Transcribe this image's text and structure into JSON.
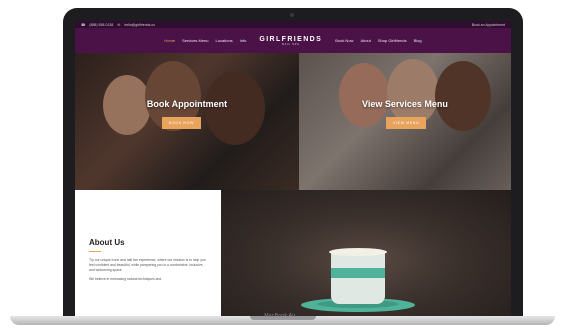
{
  "device": {
    "label": "MacBook Air"
  },
  "topbar": {
    "phone": "(888) 555-0138",
    "email": "hello@girlfriends.co",
    "right_text": "Book an Appointment"
  },
  "nav": {
    "items_left": [
      "Home",
      "Services Menu",
      "Locations",
      "Info"
    ],
    "items_right": [
      "Book Now",
      "About",
      "Shop Girlfriends",
      "Blog"
    ],
    "active": "Home"
  },
  "logo": {
    "main": "GIRLFRIENDS",
    "sub": "NAIL SPA"
  },
  "hero_left": {
    "title": "Book Appointment",
    "button": "BOOK NOW"
  },
  "hero_right": {
    "title": "View Services Menu",
    "button": "VIEW MENU"
  },
  "about": {
    "title": "About Us",
    "p1": "Try our unique bone and nail bar experience, where our mission is to help you feel confident and beautiful, while pampering you in a comfortable, inclusive, and welcoming space.",
    "p2": "We believe in embracing natural techniques and"
  },
  "colors": {
    "header_dark": "#2e0d2e",
    "header": "#4a1246",
    "accent": "#e8a45c"
  }
}
